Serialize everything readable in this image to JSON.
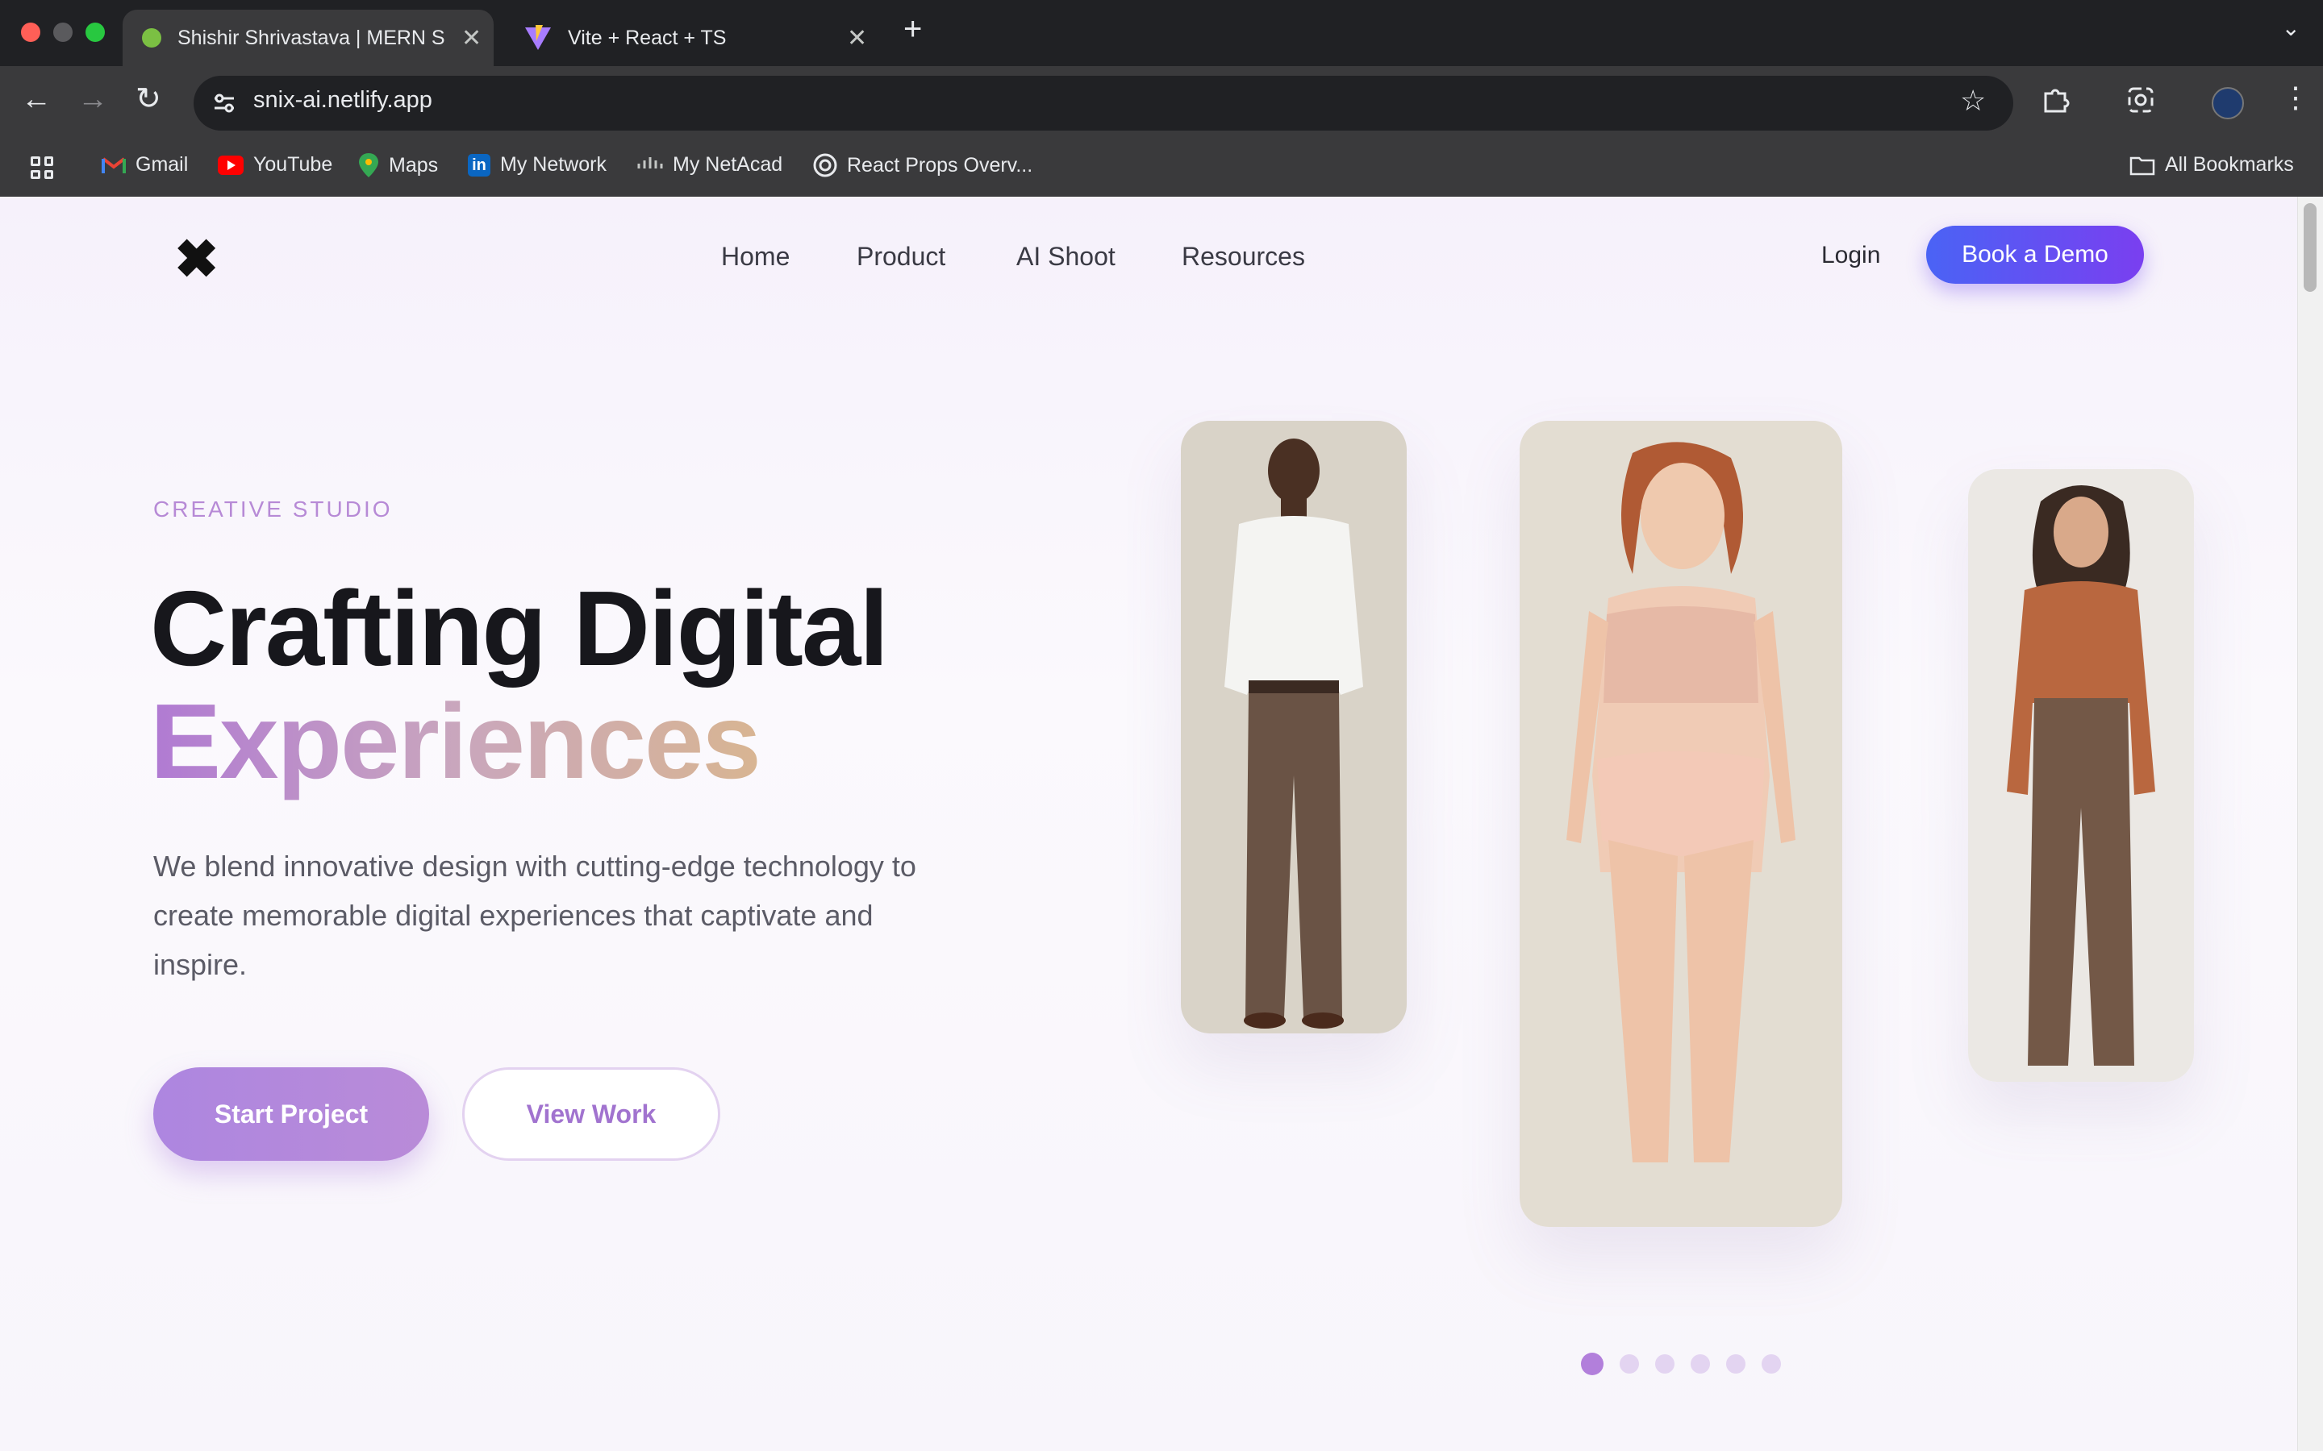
{
  "browser": {
    "tabs": [
      {
        "title": "Shishir Shrivastava | MERN St",
        "active": true
      },
      {
        "title": "Vite + React + TS",
        "active": false
      }
    ],
    "url": "snix-ai.netlify.app",
    "bookmarks": [
      "Gmail",
      "YouTube",
      "Maps",
      "My Network",
      "My NetAcad",
      "React Props Overv..."
    ],
    "all_bookmarks": "All Bookmarks",
    "icons": {
      "back": "←",
      "forward": "→",
      "reload": "↻",
      "star": "☆",
      "close": "✕",
      "new_tab": "+",
      "menu": "⋮",
      "tab_list": "⌄"
    }
  },
  "site": {
    "logo": "✖",
    "nav": [
      "Home",
      "Product",
      "AI Shoot",
      "Resources"
    ],
    "login": "Login",
    "cta": "Book a Demo",
    "accent": "#7a3ff0"
  },
  "hero": {
    "eyebrow": "CREATIVE STUDIO",
    "title_line1": "Crafting Digital",
    "title_line2": "Experiences",
    "description": "We blend innovative design with cutting-edge technology to create memorable digital experiences that captivate and inspire.",
    "primary_button": "Start Project",
    "secondary_button": "View Work"
  },
  "carousel": {
    "slides": 6,
    "active_index": 0,
    "images": [
      "model-man-white-shirt",
      "model-woman-lingerie",
      "model-woman-rust-blouse"
    ]
  }
}
